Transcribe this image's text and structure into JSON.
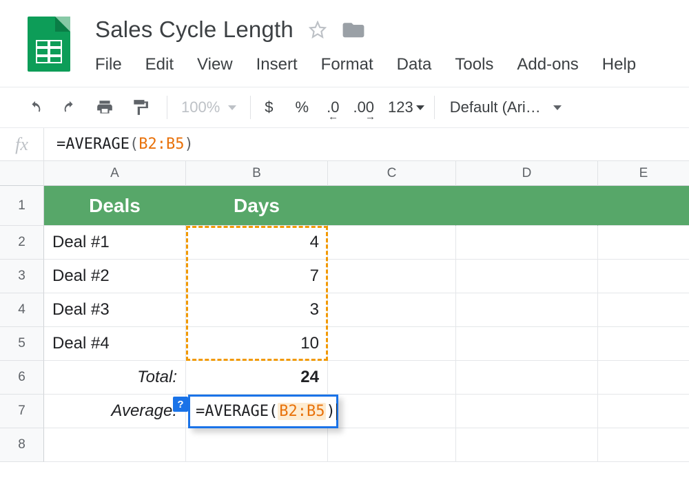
{
  "doc": {
    "title": "Sales Cycle Length"
  },
  "menus": {
    "file": "File",
    "edit": "Edit",
    "view": "View",
    "insert": "Insert",
    "format": "Format",
    "data": "Data",
    "tools": "Tools",
    "addons": "Add-ons",
    "help": "Help"
  },
  "toolbar": {
    "zoom": "100%",
    "currency": "$",
    "percent": "%",
    "dec_less": ".0",
    "dec_more": ".00",
    "numfmt": "123",
    "font": "Default (Ari…"
  },
  "formula_bar": {
    "prefix": "=",
    "func": "AVERAGE",
    "lp": "(",
    "range": "B2:B5",
    "rp": ")"
  },
  "columns": {
    "A": "A",
    "B": "B",
    "C": "C",
    "D": "D",
    "E": "E"
  },
  "rows": {
    "r1": "1",
    "r2": "2",
    "r3": "3",
    "r4": "4",
    "r5": "5",
    "r6": "6",
    "r7": "7",
    "r8": "8"
  },
  "sheet": {
    "headers": {
      "A": "Deals",
      "B": "Days"
    },
    "data": [
      {
        "deal": "Deal #1",
        "days": "4"
      },
      {
        "deal": "Deal #2",
        "days": "7"
      },
      {
        "deal": "Deal #3",
        "days": "3"
      },
      {
        "deal": "Deal #4",
        "days": "10"
      }
    ],
    "total_label": "Total:",
    "total_value": "24",
    "average_label": "Average:"
  },
  "active_cell": {
    "help": "?",
    "prefix": "=",
    "func": "AVERAGE",
    "lp": "(",
    "range": "B2:B5",
    "rp": ")"
  }
}
